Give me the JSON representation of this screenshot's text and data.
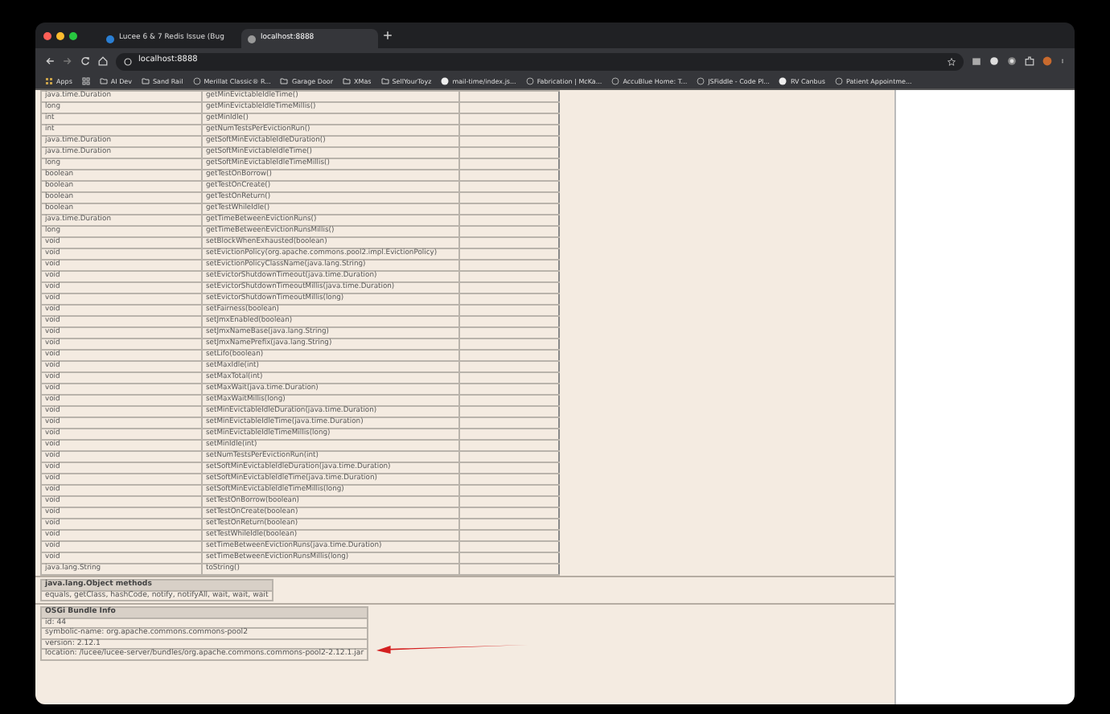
{
  "tabs": [
    {
      "title": "Lucee 6 & 7 Redis Issue (Bug",
      "selected": false
    },
    {
      "title": "localhost:8888",
      "selected": true
    }
  ],
  "address": "localhost:8888",
  "bookmarks": [
    {
      "label": "Apps",
      "kind": "apps"
    },
    {
      "label": "AI Dev",
      "kind": "folder"
    },
    {
      "label": "Sand Rail",
      "kind": "folder"
    },
    {
      "label": "Merillat Classic® R...",
      "kind": "page"
    },
    {
      "label": "Garage Door",
      "kind": "folder"
    },
    {
      "label": "XMas",
      "kind": "folder"
    },
    {
      "label": "SellYourToyz",
      "kind": "folder"
    },
    {
      "label": "mail-time/index.js...",
      "kind": "github"
    },
    {
      "label": "Fabrication | McKa...",
      "kind": "page"
    },
    {
      "label": "AccuBlue Home: T...",
      "kind": "page"
    },
    {
      "label": "JSFiddle - Code Pl...",
      "kind": "page"
    },
    {
      "label": "RV Canbus",
      "kind": "github"
    },
    {
      "label": "Patient Appointme...",
      "kind": "page"
    }
  ],
  "methods": [
    {
      "type": "java.time.Duration",
      "method": "getMinEvictableIdleTime()"
    },
    {
      "type": "long",
      "method": "getMinEvictableIdleTimeMillis()"
    },
    {
      "type": "int",
      "method": "getMinIdle()"
    },
    {
      "type": "int",
      "method": "getNumTestsPerEvictionRun()"
    },
    {
      "type": "java.time.Duration",
      "method": "getSoftMinEvictableIdleDuration()"
    },
    {
      "type": "java.time.Duration",
      "method": "getSoftMinEvictableIdleTime()"
    },
    {
      "type": "long",
      "method": "getSoftMinEvictableIdleTimeMillis()"
    },
    {
      "type": "boolean",
      "method": "getTestOnBorrow()"
    },
    {
      "type": "boolean",
      "method": "getTestOnCreate()"
    },
    {
      "type": "boolean",
      "method": "getTestOnReturn()"
    },
    {
      "type": "boolean",
      "method": "getTestWhileIdle()"
    },
    {
      "type": "java.time.Duration",
      "method": "getTimeBetweenEvictionRuns()"
    },
    {
      "type": "long",
      "method": "getTimeBetweenEvictionRunsMillis()"
    },
    {
      "type": "void",
      "method": "setBlockWhenExhausted(boolean)"
    },
    {
      "type": "void",
      "method": "setEvictionPolicy(org.apache.commons.pool2.impl.EvictionPolicy)"
    },
    {
      "type": "void",
      "method": "setEvictionPolicyClassName(java.lang.String)"
    },
    {
      "type": "void",
      "method": "setEvictorShutdownTimeout(java.time.Duration)"
    },
    {
      "type": "void",
      "method": "setEvictorShutdownTimeoutMillis(java.time.Duration)"
    },
    {
      "type": "void",
      "method": "setEvictorShutdownTimeoutMillis(long)"
    },
    {
      "type": "void",
      "method": "setFairness(boolean)"
    },
    {
      "type": "void",
      "method": "setJmxEnabled(boolean)"
    },
    {
      "type": "void",
      "method": "setJmxNameBase(java.lang.String)"
    },
    {
      "type": "void",
      "method": "setJmxNamePrefix(java.lang.String)"
    },
    {
      "type": "void",
      "method": "setLifo(boolean)"
    },
    {
      "type": "void",
      "method": "setMaxIdle(int)"
    },
    {
      "type": "void",
      "method": "setMaxTotal(int)"
    },
    {
      "type": "void",
      "method": "setMaxWait(java.time.Duration)"
    },
    {
      "type": "void",
      "method": "setMaxWaitMillis(long)"
    },
    {
      "type": "void",
      "method": "setMinEvictableIdleDuration(java.time.Duration)"
    },
    {
      "type": "void",
      "method": "setMinEvictableIdleTime(java.time.Duration)"
    },
    {
      "type": "void",
      "method": "setMinEvictableIdleTimeMillis(long)"
    },
    {
      "type": "void",
      "method": "setMinIdle(int)"
    },
    {
      "type": "void",
      "method": "setNumTestsPerEvictionRun(int)"
    },
    {
      "type": "void",
      "method": "setSoftMinEvictableIdleDuration(java.time.Duration)"
    },
    {
      "type": "void",
      "method": "setSoftMinEvictableIdleTime(java.time.Duration)"
    },
    {
      "type": "void",
      "method": "setSoftMinEvictableIdleTimeMillis(long)"
    },
    {
      "type": "void",
      "method": "setTestOnBorrow(boolean)"
    },
    {
      "type": "void",
      "method": "setTestOnCreate(boolean)"
    },
    {
      "type": "void",
      "method": "setTestOnReturn(boolean)"
    },
    {
      "type": "void",
      "method": "setTestWhileIdle(boolean)"
    },
    {
      "type": "void",
      "method": "setTimeBetweenEvictionRuns(java.time.Duration)"
    },
    {
      "type": "void",
      "method": "setTimeBetweenEvictionRunsMillis(long)"
    },
    {
      "type": "java.lang.String",
      "method": "toString()"
    }
  ],
  "object_methods": {
    "title": "java.lang.Object methods",
    "list": "equals, getClass, hashCode, notify, notifyAll, wait, wait, wait"
  },
  "bundle_info": {
    "title": "OSGi Bundle Info",
    "lines": [
      "id: 44",
      "symbolic-name: org.apache.commons.commons-pool2",
      "version: 2.12.1",
      "location: /lucee/lucee-server/bundles/org.apache.commons.commons-pool2-2.12.1.jar"
    ]
  }
}
